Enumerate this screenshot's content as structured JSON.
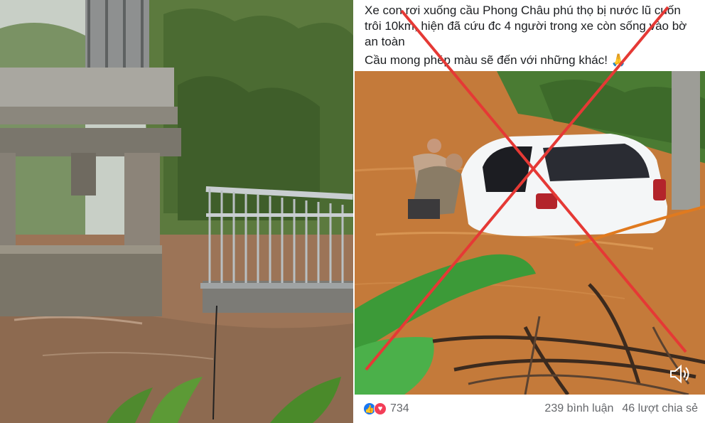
{
  "post": {
    "caption_line1": "Xe con rơi xuống cầu Phong Châu  phú thọ bị nước lũ cuốn trôi 10km, hiện đã cứu đc 4 người trong xe còn sống vào bờ an toàn",
    "caption_line2": "Cầu mong phép màu sẽ đến với những khác! 🙏",
    "reaction_count": "734",
    "comments": "239 bình luận",
    "shares": "46 lượt chia sẻ",
    "reactions": [
      "like",
      "love"
    ]
  },
  "overlay": {
    "cross_color": "#e53935"
  },
  "colors": {
    "flood_water": "#c47a3a",
    "facebook_blue": "#1877f2",
    "love_red": "#f33e58"
  }
}
